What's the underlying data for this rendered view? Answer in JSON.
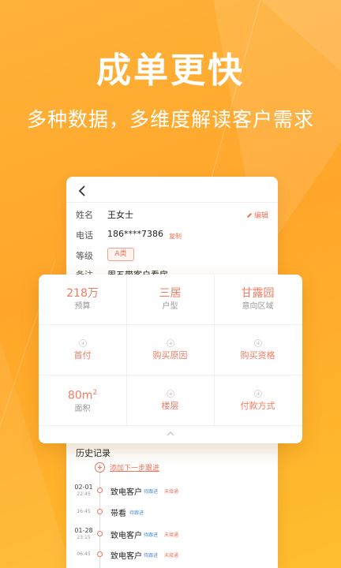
{
  "hero": {
    "title": "成单更快",
    "subtitle": "多种数据，多维度解读客户需求"
  },
  "customer": {
    "name_label": "姓名",
    "name_value": "王女士",
    "edit_label": "编辑",
    "phone_label": "电话",
    "phone_value": "186****7386",
    "copy_label": "复制",
    "level_label": "等级",
    "level_value": "A类",
    "note_label": "备注",
    "note_value": "周五带客户看房"
  },
  "panel": {
    "budget": {
      "value": "218万",
      "label": "预算"
    },
    "layout": {
      "value": "三居",
      "label": "户型"
    },
    "area_pref": {
      "value": "甘露园",
      "label": "意向区域"
    },
    "down_payment": {
      "label": "首付"
    },
    "purchase_reason": {
      "label": "购买原因"
    },
    "purchase_qualification": {
      "label": "购买资格"
    },
    "size": {
      "value": "80m",
      "sup": "2",
      "label": "面积"
    },
    "floor": {
      "label": "楼层"
    },
    "payment_method": {
      "label": "付款方式"
    }
  },
  "history": {
    "title": "历史记录",
    "add_next": "添加下一步跟进",
    "items": [
      {
        "date": "02-01",
        "time": "22:45",
        "action": "致电客户",
        "tags": [
          "待跟进",
          "未接通"
        ]
      },
      {
        "date": "",
        "time": "16:45",
        "action": "带看",
        "tags": [
          "待跟进"
        ]
      },
      {
        "date": "01-28",
        "time": "23:15",
        "action": "致电客户",
        "tags": [
          "待跟进",
          "未接通"
        ]
      },
      {
        "date": "",
        "time": "06:45",
        "action": "致电客户",
        "tags": [
          "待跟进",
          "未接通"
        ]
      }
    ]
  },
  "colors": {
    "background": "#ffa62a",
    "accent": "#f47b63",
    "tag_blue": "#4a8ad6"
  },
  "icons": {
    "back": "chevron-left-icon",
    "edit": "pencil-icon",
    "add": "plus-circle-icon",
    "collapse": "chevron-up-icon"
  }
}
